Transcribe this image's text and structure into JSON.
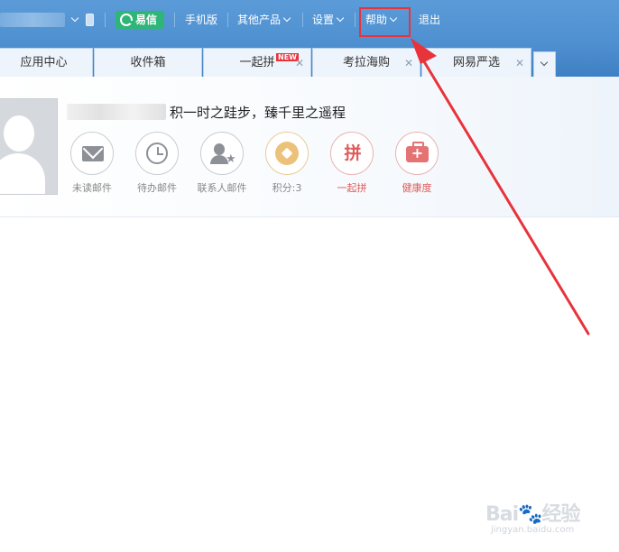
{
  "header": {
    "yixin_label": "易信",
    "mobile_label": "手机版",
    "other_products_label": "其他产品",
    "settings_label": "设置",
    "help_label": "帮助",
    "logout_label": "退出"
  },
  "tabs": [
    {
      "label": "应用中心",
      "closable": false
    },
    {
      "label": "收件箱",
      "closable": false
    },
    {
      "label": "一起拼",
      "closable": true,
      "badge": "NEW"
    },
    {
      "label": "考拉海购",
      "closable": true
    },
    {
      "label": "网易严选",
      "closable": true
    }
  ],
  "welcome": {
    "motto": "积一时之跬步，臻千里之遥程"
  },
  "shortcuts": [
    {
      "label": "未读邮件",
      "icon": "envelope-icon"
    },
    {
      "label": "待办邮件",
      "icon": "clock-icon"
    },
    {
      "label": "联系人邮件",
      "icon": "contact-star-icon"
    },
    {
      "label": "积分:3",
      "icon": "points-coin-icon"
    },
    {
      "label": "一起拼",
      "icon": "pin-icon",
      "icon_text": "拼"
    },
    {
      "label": "健康度",
      "icon": "health-kit-icon"
    }
  ],
  "watermark": {
    "main": "Bai🐾经验",
    "sub": "jingyan.baidu.com"
  },
  "colors": {
    "header_blue": "#5b9bd8",
    "yixin_green": "#2fb577",
    "highlight_red": "#e8333b",
    "warm_red": "#e05a5a"
  }
}
